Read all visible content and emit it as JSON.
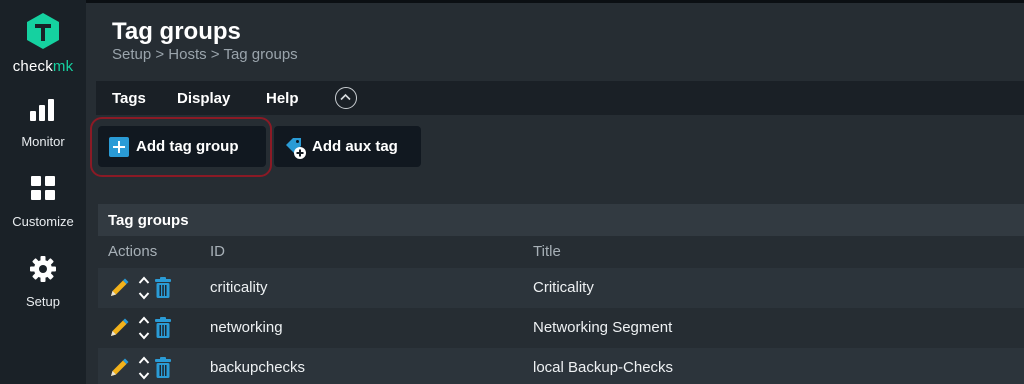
{
  "brand": {
    "name_a": "check",
    "name_b": "mk",
    "accent": "#15d1a0"
  },
  "sidebar": {
    "items": [
      {
        "label": "Monitor",
        "icon": "bar-chart-icon"
      },
      {
        "label": "Customize",
        "icon": "grid-icon"
      },
      {
        "label": "Setup",
        "icon": "gear-icon"
      }
    ]
  },
  "page": {
    "title": "Tag groups",
    "breadcrumb": "Setup > Hosts > Tag groups"
  },
  "menubar": {
    "items": [
      "Tags",
      "Display",
      "Help"
    ],
    "toggle_icon": "chevron-up-circle-icon"
  },
  "toolbar": {
    "add_tag_group": "Add tag group",
    "add_aux_tag": "Add aux tag",
    "highlight_color": "#8b1a25"
  },
  "table": {
    "title": "Tag groups",
    "headers": {
      "actions": "Actions",
      "id": "ID",
      "title": "Title"
    },
    "rows": [
      {
        "id": "criticality",
        "title": "Criticality"
      },
      {
        "id": "networking",
        "title": "Networking Segment"
      },
      {
        "id": "backupchecks",
        "title": "local Backup-Checks"
      }
    ]
  }
}
